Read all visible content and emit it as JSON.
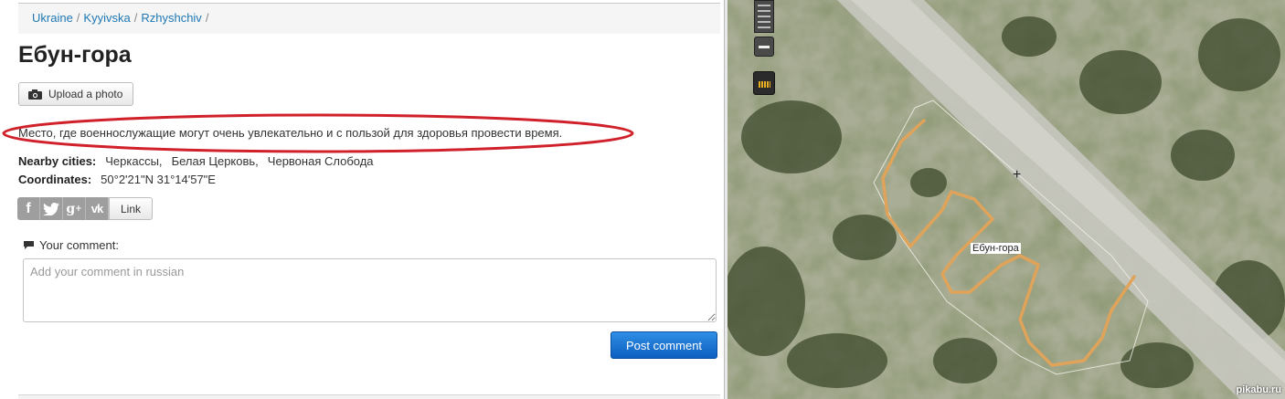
{
  "breadcrumb": {
    "items": [
      "Ukraine",
      "Kyyivska",
      "Rzhyshchiv"
    ],
    "separator": "/"
  },
  "page": {
    "title": "Ебун-гора",
    "upload_label": "Upload a photo",
    "description": "Место, где военнослужащие могут очень увлекательно и с пользой для здоровья провести время.",
    "highlight_color": "#d0202a"
  },
  "info": {
    "nearby_label": "Nearby cities:",
    "nearby_cities": [
      "Черкассы,",
      "Белая Церковь,",
      "Червоная Слобода"
    ],
    "coords_label": "Coordinates:",
    "coords_value": "50°2'21\"N 31°14'57\"E"
  },
  "share": {
    "icons": [
      "facebook-icon",
      "twitter-icon",
      "google-plus-icon",
      "vk-icon"
    ],
    "link_label": "Link"
  },
  "comment": {
    "label": "Your comment:",
    "placeholder": "Add your comment in russian",
    "submit_label": "Post comment"
  },
  "map": {
    "place_label": "Ебун-гора",
    "route_color": "#e0a35a",
    "watermark": "pikabu.ru"
  }
}
